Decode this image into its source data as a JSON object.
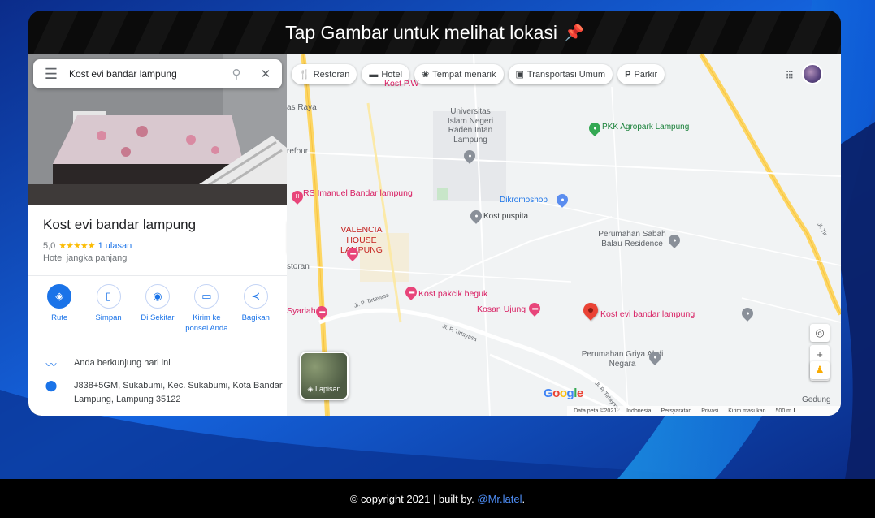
{
  "page": {
    "header_title": "Tap Gambar untuk melihat lokasi",
    "header_icon": "pushpin-icon"
  },
  "panel": {
    "search_query": "Kost evi bandar lampung",
    "place_name": "Kost evi bandar lampung",
    "rating_value": "5,0",
    "stars": "★★★★★",
    "reviews": "1 ulasan",
    "category": "Hotel jangka panjang",
    "actions": [
      {
        "label": "Rute",
        "icon": "directions-icon"
      },
      {
        "label": "Simpan",
        "icon": "bookmark-icon"
      },
      {
        "label": "Di Sekitar",
        "icon": "nearby-icon"
      },
      {
        "label": "Kirim ke ponsel Anda",
        "icon": "send-to-phone-icon"
      },
      {
        "label": "Bagikan",
        "icon": "share-icon"
      }
    ],
    "popular_times": "Anda berkunjung hari ini",
    "address": "J838+5GM, Sukabumi, Kec. Sukabumi, Kota Bandar Lampung, Lampung 35122"
  },
  "map": {
    "chips": [
      {
        "label": "Restoran",
        "icon": "restaurant-icon"
      },
      {
        "label": "Hotel",
        "icon": "hotel-icon"
      },
      {
        "label": "Tempat menarik",
        "icon": "attraction-icon"
      },
      {
        "label": "Transportasi Umum",
        "icon": "transit-icon"
      },
      {
        "label": "Parkir",
        "icon": "parking-icon"
      }
    ],
    "labels": {
      "uin": "Universitas Islam Negeri Raden Intan Lampung",
      "pkk": "PKK Agropark Lampung",
      "kost_kw": "Kost P.W",
      "as_raya": "as Raya",
      "refour": "refour",
      "rs_imanuel": "RS Imanuel Bandar lampung",
      "dikromoshop": "Dikromoshop",
      "kost_puspita": "Kost puspita",
      "valencia": "VALENCIA HOUSE LAMPUNG",
      "perumahan_sabah": "Perumahan Sabah Balau Residence",
      "storan": "storan",
      "kost_pakcik": "Kost pakcik beguk",
      "syariah": "Syariah",
      "kosan_ujung": "Kosan Ujung",
      "kost_evi": "Kost evi bandar lampung",
      "tirtayasa1": "Jl. P. Tirtayasa",
      "tirtayasa2": "Jl. P. Tirtayasa",
      "tirtayasa3": "Jl. P. Tirtayasa",
      "perumahan_griya": "Perumahan Griya Abdi Negara",
      "road_right": "Jl. Tir",
      "gedung": "Gedung",
      "layer": "Lapisan"
    },
    "footer": {
      "data": "Data peta ©2021",
      "country": "Indonesia",
      "terms": "Persyaratan",
      "privacy": "Privasi",
      "feedback": "Kirim masukan",
      "scale": "500 m"
    },
    "google": "Google"
  },
  "footer": {
    "copyright": "© copyright 2021 | built by.",
    "author": "@Mr.latel",
    "suffix": "."
  }
}
